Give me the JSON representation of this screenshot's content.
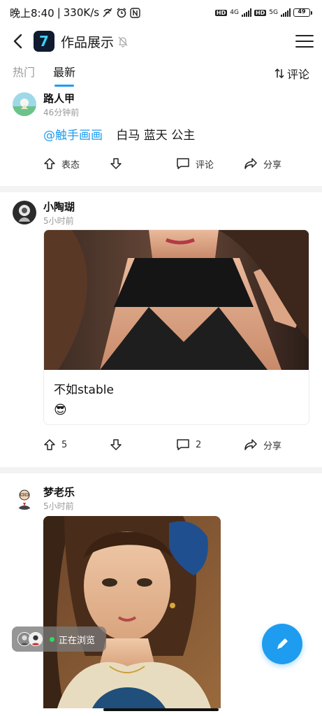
{
  "status_bar": {
    "time": "晚上8:40",
    "speed": "330K/s",
    "network_1": "4G",
    "network_2": "5G",
    "hd_badge": "HD",
    "battery": "49",
    "battery_level": 0.49
  },
  "header": {
    "app_icon_glyph": "7",
    "title": "作品展示"
  },
  "tabs": {
    "items": [
      {
        "label": "热门",
        "active": false
      },
      {
        "label": "最新",
        "active": true
      }
    ],
    "sort_label": "评论"
  },
  "posts": [
    {
      "author": "路人甲",
      "time": "46分钟前",
      "mention": "@触手画画",
      "text": "白马 蓝天 公主",
      "actions": {
        "up": "表态",
        "comment": "评论",
        "share": "分享"
      }
    },
    {
      "author": "小陶瑚",
      "time": "5小时前",
      "card_title": "不如stable",
      "emoji": "😎",
      "actions": {
        "up": "5",
        "comment": "2",
        "share": "分享"
      }
    },
    {
      "author": "梦老乐",
      "time": "5小时前"
    }
  ],
  "floating": {
    "browsing_label": "正在浏览"
  },
  "colors": {
    "accent": "#1e9cf0",
    "online_dot": "#2fdc5a"
  }
}
